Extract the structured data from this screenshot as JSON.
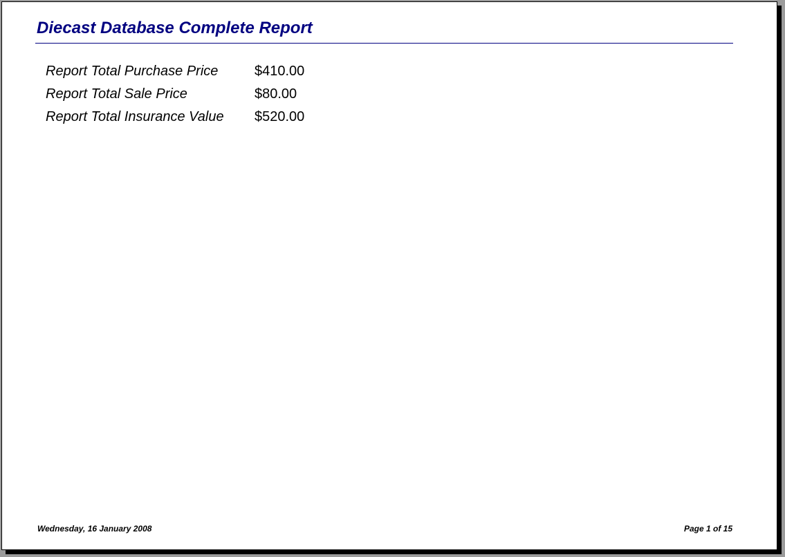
{
  "report": {
    "title": "Diecast Database Complete Report",
    "title_color": "#000080"
  },
  "totals": [
    {
      "label": "Report Total Purchase Price",
      "value": "$410.00"
    },
    {
      "label": "Report Total Sale Price",
      "value": "$80.00"
    },
    {
      "label": "Report Total Insurance Value",
      "value": "$520.00"
    }
  ],
  "footer": {
    "date": "Wednesday, 16 January 2008",
    "page": "Page 1 of 15"
  }
}
